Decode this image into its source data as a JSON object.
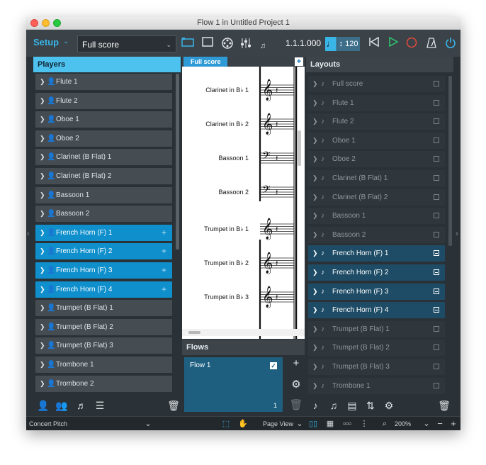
{
  "window": {
    "title": "Flow 1 in Untitled Project 1"
  },
  "toolbar": {
    "mode": "Setup",
    "layout_selected": "Full score",
    "position": "1.1.1.000",
    "tempo": "120"
  },
  "players_panel": {
    "title": "Players",
    "items": [
      {
        "label": "Flute 1",
        "selected": false
      },
      {
        "label": "Flute 2",
        "selected": false
      },
      {
        "label": "Oboe 1",
        "selected": false
      },
      {
        "label": "Oboe 2",
        "selected": false
      },
      {
        "label": "Clarinet (B Flat) 1",
        "selected": false
      },
      {
        "label": "Clarinet (B Flat) 2",
        "selected": false
      },
      {
        "label": "Bassoon 1",
        "selected": false
      },
      {
        "label": "Bassoon 2",
        "selected": false
      },
      {
        "label": "French Horn (F) 1",
        "selected": true
      },
      {
        "label": "French Horn (F) 2",
        "selected": true
      },
      {
        "label": "French Horn (F) 3",
        "selected": true
      },
      {
        "label": "French Horn (F) 4",
        "selected": true
      },
      {
        "label": "Trumpet (B Flat) 1",
        "selected": false
      },
      {
        "label": "Trumpet (B Flat) 2",
        "selected": false
      },
      {
        "label": "Trumpet (B Flat) 3",
        "selected": false
      },
      {
        "label": "Trombone 1",
        "selected": false
      },
      {
        "label": "Trombone 2",
        "selected": false
      }
    ]
  },
  "score": {
    "tab": "Full score",
    "staves": [
      {
        "label": "Clarinet in B♭ 1",
        "clef": "treble"
      },
      {
        "label": "Clarinet in B♭ 2",
        "clef": "treble"
      },
      {
        "label": "Bassoon 1",
        "clef": "bass"
      },
      {
        "label": "Bassoon 2",
        "clef": "bass"
      },
      {
        "label": "Trumpet in B♭ 1",
        "clef": "treble"
      },
      {
        "label": "Trumpet in B♭ 2",
        "clef": "treble"
      },
      {
        "label": "Trumpet in B♭ 3",
        "clef": "treble"
      }
    ]
  },
  "flows_panel": {
    "title": "Flows",
    "flow": {
      "title": "Flow 1",
      "number": "1"
    }
  },
  "layouts_panel": {
    "title": "Layouts",
    "items": [
      {
        "label": "Full score",
        "selected": false
      },
      {
        "label": "Flute 1",
        "selected": false
      },
      {
        "label": "Flute 2",
        "selected": false
      },
      {
        "label": "Oboe 1",
        "selected": false
      },
      {
        "label": "Oboe 2",
        "selected": false
      },
      {
        "label": "Clarinet (B Flat) 1",
        "selected": false
      },
      {
        "label": "Clarinet (B Flat) 2",
        "selected": false
      },
      {
        "label": "Bassoon 1",
        "selected": false
      },
      {
        "label": "Bassoon 2",
        "selected": false
      },
      {
        "label": "French Horn (F) 1",
        "selected": true
      },
      {
        "label": "French Horn (F) 2",
        "selected": true
      },
      {
        "label": "French Horn (F) 3",
        "selected": true
      },
      {
        "label": "French Horn (F) 4",
        "selected": true
      },
      {
        "label": "Trumpet (B Flat) 1",
        "selected": false
      },
      {
        "label": "Trumpet (B Flat) 2",
        "selected": false
      },
      {
        "label": "Trumpet (B Flat) 3",
        "selected": false
      },
      {
        "label": "Trombone 1",
        "selected": false
      }
    ]
  },
  "statusbar": {
    "pitch": "Concert Pitch",
    "view": "Page View",
    "zoom": "200%"
  },
  "colors": {
    "accent": "#39b5e8",
    "selected_player": "#0f8fcc",
    "selected_layout": "#1e4c66",
    "panel_bg": "#2b3237"
  }
}
